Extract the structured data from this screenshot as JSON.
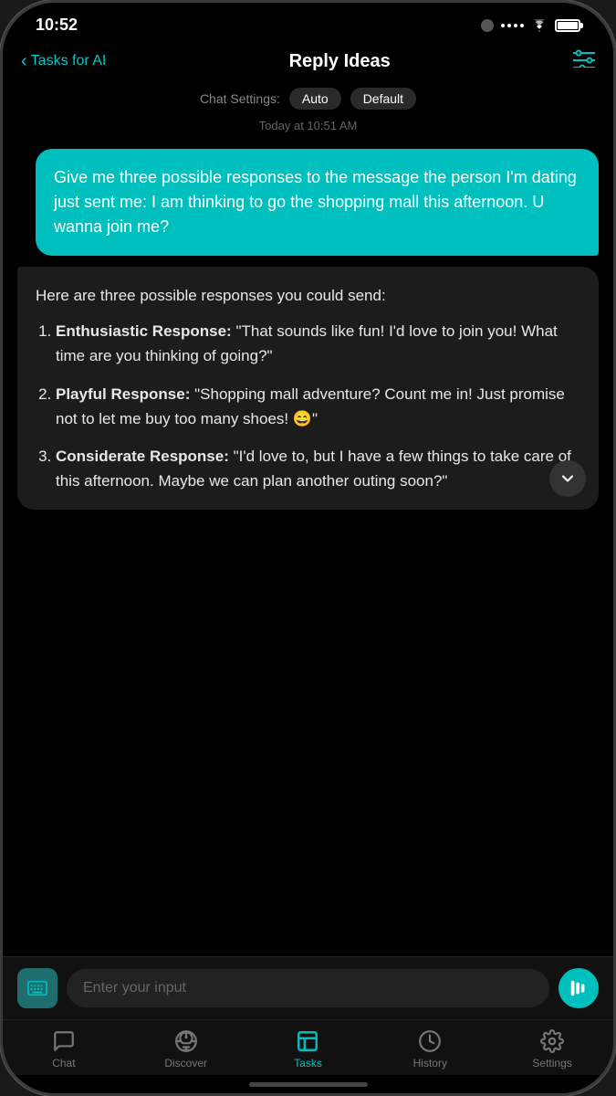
{
  "statusBar": {
    "time": "10:52"
  },
  "header": {
    "backLabel": "Tasks for AI",
    "title": "Reply Ideas"
  },
  "chatSettings": {
    "label": "Chat Settings:",
    "mode": "Auto",
    "style": "Default"
  },
  "timestamp": "Today at 10:51 AM",
  "userMessage": "Give me three possible responses to the message the person I'm dating just sent me: I am thinking to go the shopping mall this afternoon. U wanna join me?",
  "aiMessage": {
    "intro": "Here are three possible responses you could send:",
    "responses": [
      {
        "label": "Enthusiastic Response:",
        "text": "\"That sounds like fun! I'd love to join you! What time are you thinking of going?\""
      },
      {
        "label": "Playful Response:",
        "text": "\"Shopping mall adventure? Count me in! Just promise not to let me buy too many shoes! 😄\""
      },
      {
        "label": "Considerate Response:",
        "text": "\"I'd love to, but I have a few things to take care of this afternoon. Maybe we can plan another outing soon?\""
      }
    ]
  },
  "inputPlaceholder": "Enter your input",
  "nav": {
    "items": [
      {
        "id": "chat",
        "label": "Chat",
        "active": false
      },
      {
        "id": "discover",
        "label": "Discover",
        "active": false
      },
      {
        "id": "tasks",
        "label": "Tasks",
        "active": true
      },
      {
        "id": "history",
        "label": "History",
        "active": false
      },
      {
        "id": "settings",
        "label": "Settings",
        "active": false
      }
    ]
  },
  "colors": {
    "accent": "#00bfbf",
    "userBubble": "#00bfbf",
    "aiBubble": "#1c1c1c"
  }
}
